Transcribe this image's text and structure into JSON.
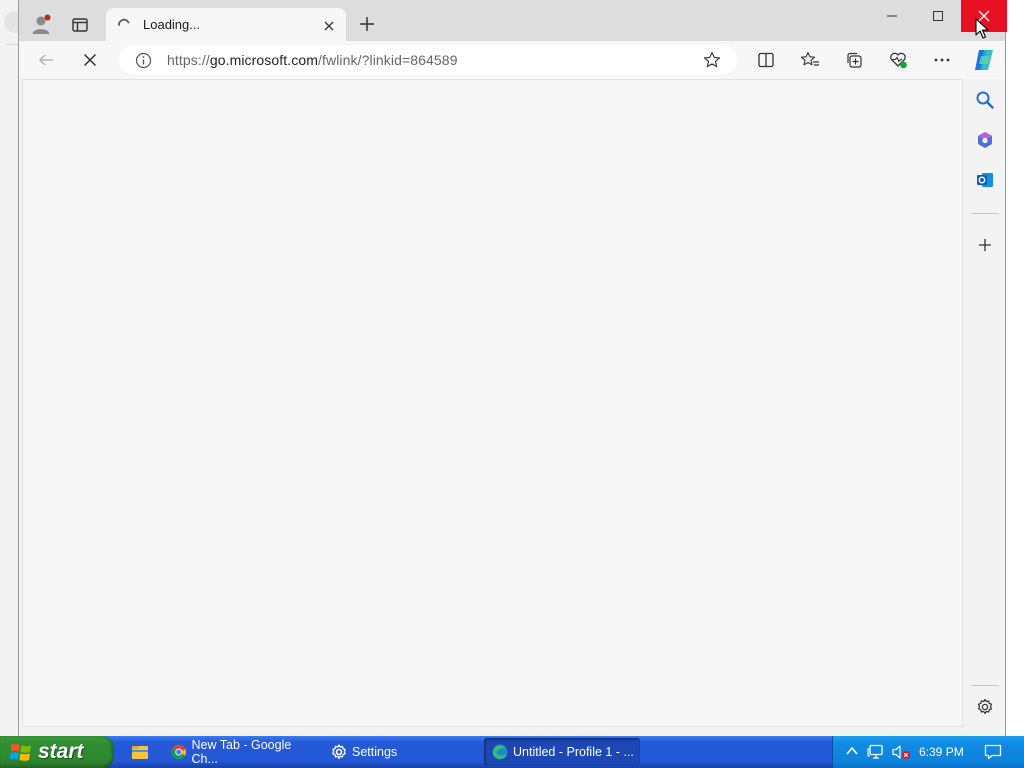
{
  "browser": {
    "tab": {
      "title": "Loading...",
      "close_icon": "close-icon"
    },
    "address_bar": {
      "url_prefix": "https://",
      "url_host": "go.microsoft.com",
      "url_path": "/fwlink/?linkid=864589"
    },
    "window_controls": [
      "minimize",
      "maximize",
      "close"
    ],
    "close_button_color": "#e81123"
  },
  "taskbar": {
    "start_label": "start",
    "tasks": [
      {
        "label": "New Tab - Google Ch...",
        "icon": "chrome-icon"
      },
      {
        "label": "Settings",
        "icon": "gear-icon"
      },
      {
        "label": "Untitled - Profile 1 - ...",
        "icon": "edge-icon",
        "active": true
      }
    ],
    "clock": "6:39 PM"
  }
}
